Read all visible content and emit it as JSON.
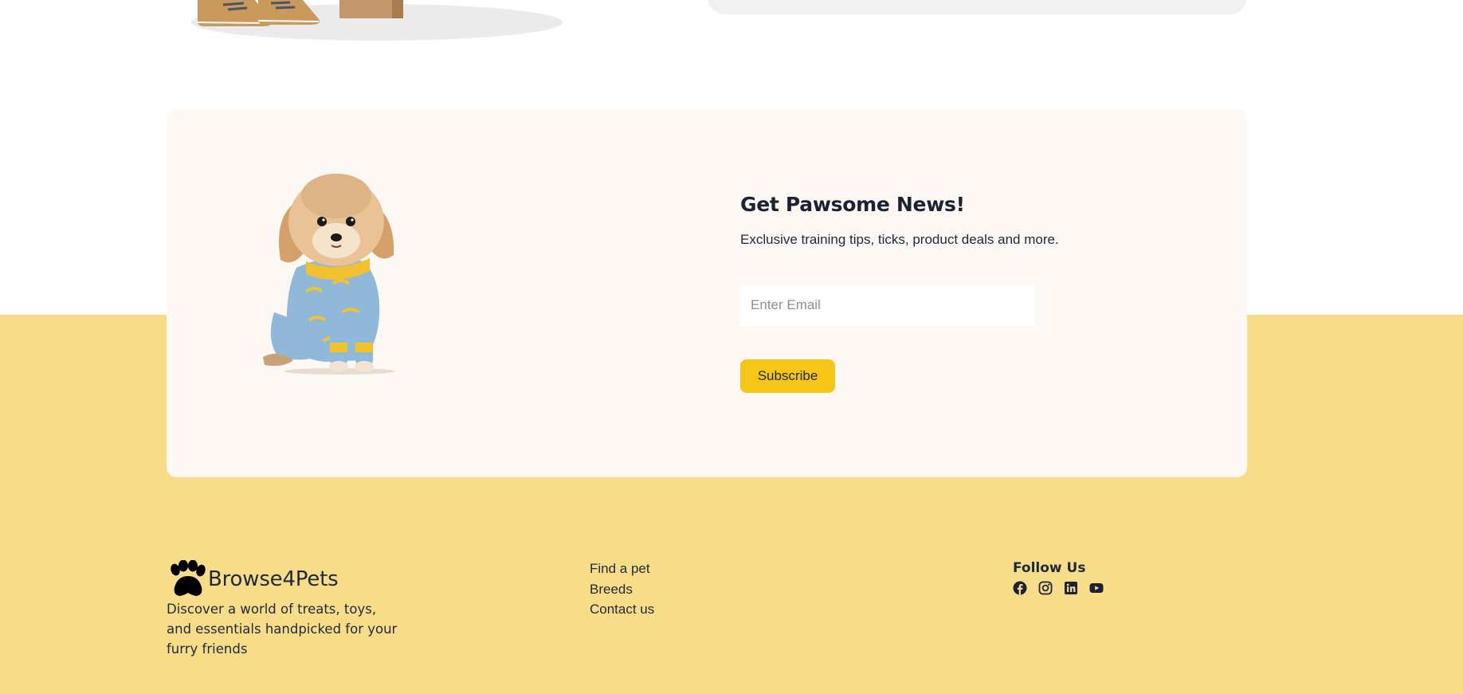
{
  "newsletter": {
    "title": "Get Pawsome News!",
    "description": "Exclusive training tips, ticks, product deals and more.",
    "email_placeholder": "Enter Email",
    "subscribe_label": "Subscribe"
  },
  "footer": {
    "brand_name": "Browse4Pets",
    "brand_description": "Discover a world of treats, toys, and essentials handpicked for your furry friends",
    "links": [
      "Find a pet",
      "Breeds",
      "Contact us"
    ],
    "follow_title": "Follow Us",
    "social": [
      "facebook-icon",
      "instagram-icon",
      "linkedin-icon",
      "youtube-icon"
    ]
  },
  "colors": {
    "footer_background": "#f8dd89",
    "card_background": "#fdf8f3",
    "accent": "#f5c518",
    "text": "#1e293b"
  }
}
